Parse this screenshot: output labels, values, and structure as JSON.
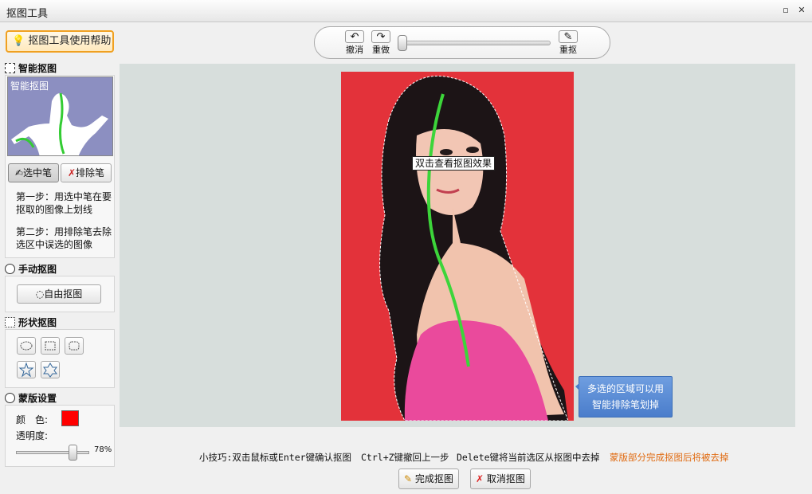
{
  "window": {
    "title": "抠图工具",
    "maximize_glyph": "▫",
    "close_glyph": "✕"
  },
  "left": {
    "help_button": "抠图工具使用帮助",
    "smart": {
      "heading": "智能抠图",
      "thumb_label": "智能抠图",
      "select_pen": "选中笔",
      "exclude_pen": "排除笔",
      "step1": "第一步：用选中笔在要抠取的图像上划线",
      "step2": "第二步：用排除笔去除选区中误选的图像"
    },
    "manual": {
      "heading": "手动抠图",
      "free_button": "自由抠图"
    },
    "shape": {
      "heading": "形状抠图"
    },
    "mask": {
      "heading": "蒙版设置",
      "color_label": "颜　色:",
      "color": "#ff0000",
      "opacity_label": "透明度:",
      "opacity_value": "78%",
      "opacity_fraction": 0.78
    }
  },
  "toolbar": {
    "undo": "撤消",
    "redo": "重做",
    "redraw": "重抠",
    "undo_icon": "↶",
    "redo_icon": "↷",
    "redraw_icon": "✎"
  },
  "canvas": {
    "tooltip": "双击查看抠图效果",
    "hint_line1": "多选的区域可以用",
    "hint_line2": "智能排除笔划掉",
    "photo_bg": "#e3323a"
  },
  "tips": {
    "tip1": "小技巧:双击鼠标或Enter键确认抠图",
    "tip2": "Ctrl+Z键撤回上一步",
    "tip3": "Delete键将当前选区从抠图中去掉",
    "tip4": "蒙版部分完成抠图后将被去掉",
    "tip4_color": "#e06a10"
  },
  "actions": {
    "finish": "完成抠图",
    "cancel": "取消抠图"
  }
}
